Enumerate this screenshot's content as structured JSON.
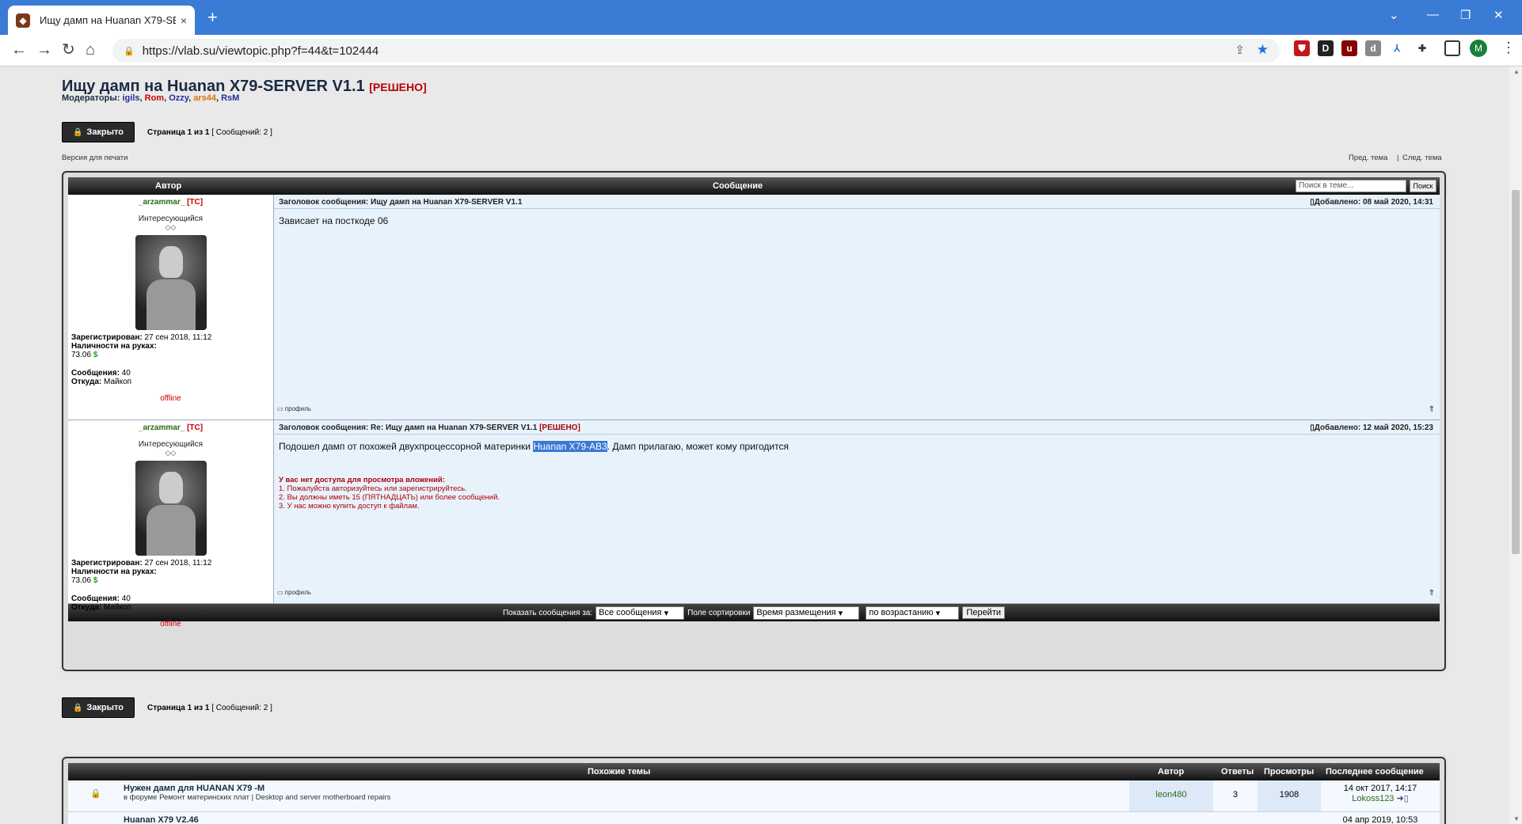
{
  "browser": {
    "tab_title": "Ищу дамп на Huanan X79-SERV",
    "tab_close": "×",
    "new_tab": "+",
    "url": "https://vlab.su/viewtopic.php?f=44&t=102444",
    "avatar_letter": "M",
    "extensions": [
      "shield",
      "D",
      "uBlock",
      "d",
      "ext",
      "puzzle",
      "sidebar"
    ],
    "icons": [
      "back-icon",
      "forward-icon",
      "reload-icon",
      "home-icon",
      "lock-icon",
      "share-icon",
      "star-icon"
    ]
  },
  "topic": {
    "title": "Ищу дамп на Huanan X79-SERVER V1.1",
    "solved": "[РЕШЕНО]",
    "moderators_label": "Модераторы:",
    "moderators": [
      {
        "name": "igils",
        "color": "#2a2a9a"
      },
      {
        "name": "Rom",
        "color": "#d00000"
      },
      {
        "name": "Ozzy",
        "color": "#2a2a9a"
      },
      {
        "name": "ars44",
        "color": "#e07000"
      },
      {
        "name": "RsM",
        "color": "#2a2a9a"
      }
    ],
    "locked_label": "Закрыто",
    "pagination_prefix": "Страница",
    "page_current": "1",
    "page_of": "из",
    "page_total": "1",
    "posts_count": "[ Сообщений: 2 ]",
    "print_version": "Версия для печати",
    "prev_topic": "Пред. тема",
    "sep": "|",
    "next_topic": "След. тема"
  },
  "posts_table": {
    "col_author": "Автор",
    "col_message": "Сообщение",
    "search_placeholder": "Поиск в теме...",
    "search_button": "Поиск",
    "posts": [
      {
        "author": "_arzammar_",
        "ts": "[ТС]",
        "rank": "Интересующийся",
        "gems": "◇◇",
        "registered_label": "Зарегистрирован:",
        "registered": "27 сен 2018, 11:12",
        "cash_label": "Наличности на руках:",
        "cash": "73.06",
        "currency": "$",
        "messages_label": "Сообщения:",
        "messages": "40",
        "from_label": "Откуда:",
        "from": "Майкоп",
        "status": "offline",
        "subject_label": "Заголовок сообщения:",
        "subject": "Ищу дамп на Huanan X79-SERVER V1.1",
        "subject_solved": "",
        "date_label": "Добавлено:",
        "date": "08 май 2020, 14:31",
        "text": "Зависает на посткоде 06",
        "profile": "профиль"
      },
      {
        "author": "_arzammar_",
        "ts": "[ТС]",
        "rank": "Интересующийся",
        "gems": "◇◇",
        "registered_label": "Зарегистрирован:",
        "registered": "27 сен 2018, 11:12",
        "cash_label": "Наличности на руках:",
        "cash": "73.06",
        "currency": "$",
        "messages_label": "Сообщения:",
        "messages": "40",
        "from_label": "Откуда:",
        "from": "Майкоп",
        "status": "offline",
        "subject_label": "Заголовок сообщения:",
        "subject": "Re: Ищу дамп на Huanan X79-SERVER V1.1",
        "subject_solved": "[РЕШЕНО]",
        "date_label": "Добавлено:",
        "date": "12 май 2020, 15:23",
        "text_before": "Подошел дамп от похожей двухпроцессорной материнки ",
        "text_highlight": "Huanan X79-AB3",
        "text_after": ". Дамп прилагаю, может кому пригодится",
        "warn_title": "У вас нет доступа для просмотра вложений:",
        "warn_1": "1. Пожалуйста авторизуйтесь или зарегистрируйтесь.",
        "warn_2": "2. Вы должны иметь 15 (ПЯТНАДЦАТЬ) или более сообщений.",
        "warn_3": "3. У нас можно купить доступ к файлам.",
        "profile": "профиль"
      }
    ],
    "footer": {
      "show_label": "Показать сообщения за:",
      "show_value": "Все сообщения",
      "sort_label": "Поле сортировки",
      "sort_value": "Время размещения",
      "order_value": "по возрастанию",
      "go": "Перейти"
    }
  },
  "similar": {
    "header": "Похожие темы",
    "col_author": "Автор",
    "col_replies": "Ответы",
    "col_views": "Просмотры",
    "col_last": "Последнее сообщение",
    "rows": [
      {
        "title": "Нужен дамп для HUANAN X79 -M",
        "forum_prefix": "в форуме",
        "forum": "Ремонт материнских плат | Desktop and server motherboard repairs",
        "author": "leon480",
        "replies": "3",
        "views": "1908",
        "last_date": "14 окт 2017, 14:17",
        "last_user": "Lokoss123"
      },
      {
        "title": "Huanan X79 V2.46",
        "last_date": "04 апр 2019, 10:53"
      }
    ]
  }
}
